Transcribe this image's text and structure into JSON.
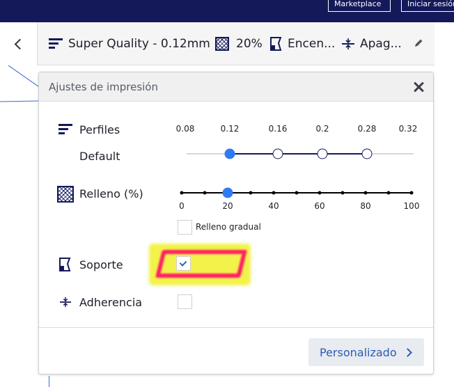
{
  "topbar": {
    "marketplace_label": "Marketplace",
    "login_label": "Iniciar sesión"
  },
  "header": {
    "profile_label": "Super Quality - 0.12mm",
    "infill_label": "20%",
    "support_label": "Encen...",
    "adhesion_label": "Apag...",
    "icons": [
      "chevron-left-icon",
      "profile-icon",
      "infill-icon",
      "support-icon",
      "adhesion-icon",
      "pencil-icon"
    ]
  },
  "panel": {
    "title": "Ajustes de impresión",
    "profiles": {
      "label": "Perfiles",
      "sublabel": "Default",
      "ticks": [
        "0.08",
        "0.12",
        "0.16",
        "0.2",
        "0.28",
        "0.32"
      ],
      "selected": "0.12",
      "available": [
        "0.12",
        "0.16",
        "0.2",
        "0.28"
      ]
    },
    "infill": {
      "label": "Relleno (%)",
      "ticks": [
        "0",
        "20",
        "40",
        "60",
        "80",
        "100"
      ],
      "value": 20,
      "gradual_label": "Relleno gradual",
      "gradual_checked": false
    },
    "support": {
      "label": "Soporte",
      "checked": true
    },
    "adhesion": {
      "label": "Adherencia",
      "checked": false
    },
    "custom_button_label": "Personalizado"
  },
  "colors": {
    "navy": "#14195a",
    "accent_blue": "#2e7cf2",
    "link_blue": "#2d5bb7",
    "highlight_yellow": "#f2f24a",
    "highlight_pink": "#ff1e66"
  }
}
